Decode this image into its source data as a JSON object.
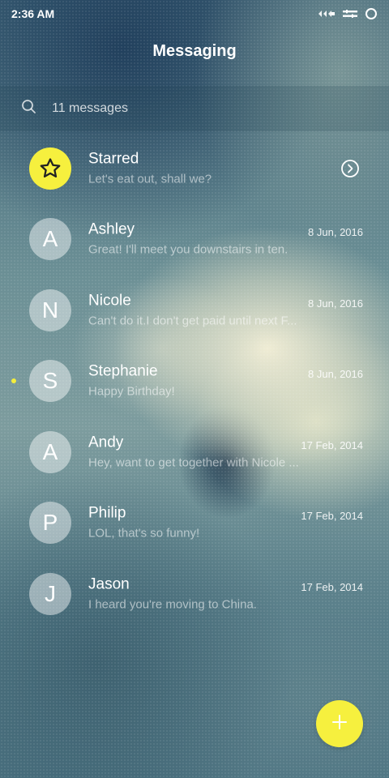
{
  "status_bar": {
    "time": "2:36 AM"
  },
  "header": {
    "title": "Messaging"
  },
  "search": {
    "count_label": "11 messages"
  },
  "starred": {
    "name": "Starred",
    "snippet": "Let's eat out, shall we?"
  },
  "conversations": [
    {
      "initial": "A",
      "name": "Ashley",
      "date": "8 Jun, 2016",
      "snippet": "Great! I'll meet you downstairs in ten.",
      "unread": false
    },
    {
      "initial": "N",
      "name": "Nicole",
      "date": "8 Jun, 2016",
      "snippet": "Can't do it.I don't get paid until next F...",
      "unread": false
    },
    {
      "initial": "S",
      "name": "Stephanie",
      "date": "8 Jun, 2016",
      "snippet": "Happy Birthday!",
      "unread": true
    },
    {
      "initial": "A",
      "name": "Andy",
      "date": "17 Feb, 2014",
      "snippet": "Hey, want to get together with Nicole ...",
      "unread": false
    },
    {
      "initial": "P",
      "name": "Philip",
      "date": "17 Feb, 2014",
      "snippet": "LOL, that's so funny!",
      "unread": false
    },
    {
      "initial": "J",
      "name": "Jason",
      "date": "17 Feb, 2014",
      "snippet": "I heard you're moving to China.",
      "unread": false
    }
  ],
  "colors": {
    "accent": "#f6f03e",
    "unread_dot": "#f4ee3c"
  },
  "icons": {
    "search": "search-icon",
    "star": "star-icon",
    "arrow": "chevron-right-circle-icon",
    "fab": "plus-icon"
  }
}
